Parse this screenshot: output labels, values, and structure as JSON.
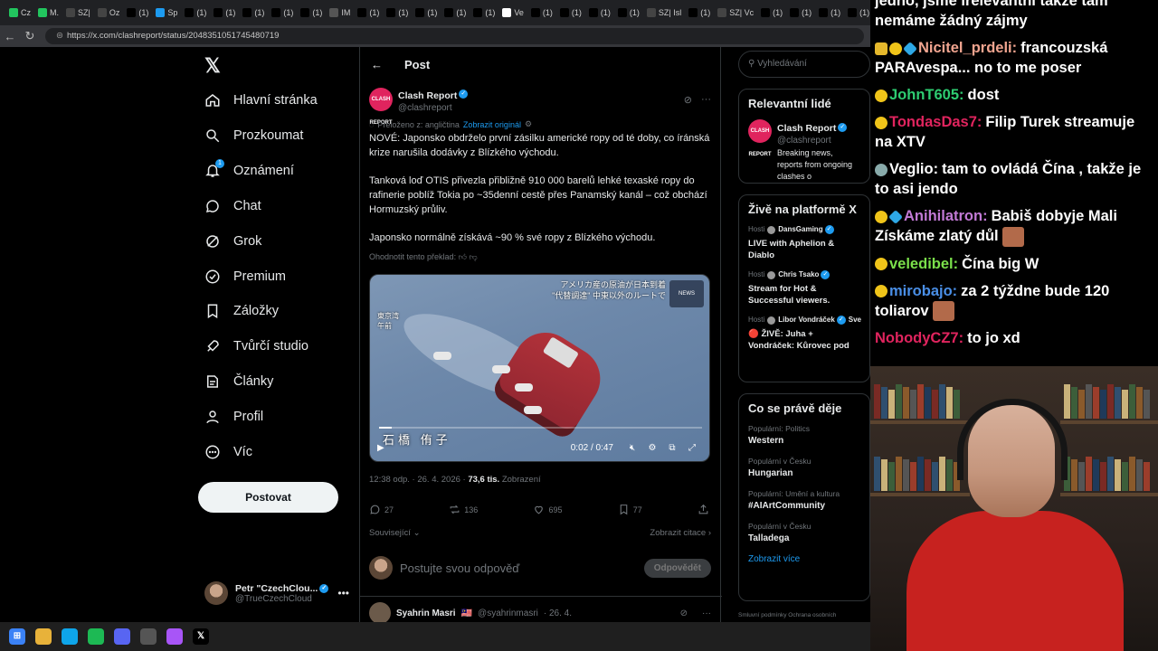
{
  "browser": {
    "tabs": [
      {
        "label": "Cz",
        "color": "#22c55e"
      },
      {
        "label": "M.",
        "color": "#22c55e"
      },
      {
        "label": "SZ|",
        "color": "#444"
      },
      {
        "label": "Oz",
        "color": "#444"
      },
      {
        "label": "(1)",
        "color": "#000"
      },
      {
        "label": "Sp",
        "color": "#1d9bf0"
      },
      {
        "label": "(1)",
        "color": "#000"
      },
      {
        "label": "(1)",
        "color": "#000"
      },
      {
        "label": "(1)",
        "color": "#000"
      },
      {
        "label": "(1)",
        "color": "#000"
      },
      {
        "label": "(1)",
        "color": "#000"
      },
      {
        "label": "IM",
        "color": "#555"
      },
      {
        "label": "(1)",
        "color": "#000"
      },
      {
        "label": "(1)",
        "color": "#000"
      },
      {
        "label": "(1)",
        "color": "#000"
      },
      {
        "label": "(1)",
        "color": "#000"
      },
      {
        "label": "(1)",
        "color": "#000"
      },
      {
        "label": "Ve",
        "color": "#fff"
      },
      {
        "label": "(1)",
        "color": "#000"
      },
      {
        "label": "(1)",
        "color": "#000"
      },
      {
        "label": "(1)",
        "color": "#000"
      },
      {
        "label": "(1)",
        "color": "#000"
      },
      {
        "label": "SZ| Isl",
        "color": "#444"
      },
      {
        "label": "(1)",
        "color": "#000"
      },
      {
        "label": "SZ| Vc",
        "color": "#444"
      },
      {
        "label": "(1)",
        "color": "#000"
      },
      {
        "label": "(1)",
        "color": "#000"
      },
      {
        "label": "(1)",
        "color": "#000"
      },
      {
        "label": "(1)",
        "color": "#000"
      },
      {
        "label": "(1)",
        "color": "#000"
      }
    ],
    "url": "https://x.com/clashreport/status/2048351051745480719"
  },
  "nav": {
    "items": [
      {
        "label": "Hlavní stránka",
        "icon": "home-icon"
      },
      {
        "label": "Prozkoumat",
        "icon": "search-icon"
      },
      {
        "label": "Oznámení",
        "icon": "bell-icon",
        "badge": "1"
      },
      {
        "label": "Chat",
        "icon": "chat-icon"
      },
      {
        "label": "Grok",
        "icon": "grok-icon"
      },
      {
        "label": "Premium",
        "icon": "premium-icon"
      },
      {
        "label": "Záložky",
        "icon": "bookmark-icon"
      },
      {
        "label": "Tvůrčí studio",
        "icon": "rocket-icon"
      },
      {
        "label": "Články",
        "icon": "article-icon"
      },
      {
        "label": "Profil",
        "icon": "profile-icon"
      },
      {
        "label": "Víc",
        "icon": "more-icon"
      }
    ],
    "post_button": "Postovat",
    "account": {
      "name": "Petr \"CzechClou...",
      "handle": "@TrueCzechCloud"
    }
  },
  "timeline": {
    "title": "Post",
    "post": {
      "author": "Clash Report",
      "handle": "@clashreport",
      "avatar_text": "CLASH REPORT",
      "translated_from": "Přeloženo z: angličtina",
      "show_original": "Zobrazit originál",
      "paragraphs": [
        "NOVÉ: Japonsko obdrželo první zásilku americké ropy od té doby, co íránská krize narušila dodávky z Blízkého východu.",
        "Tanková loď OTIS přivezla přibližně 910 000 barelů lehké texaské ropy do rafinerie poblíž Tokia po ~35denní cestě přes Panamský kanál – což obchází Hormuzský průliv.",
        "Japonsko normálně získává ~90 % své ropy z Blízkého východu."
      ],
      "rate_translation": "Ohodnotit tento překlad:",
      "video": {
        "caption_line1": "アメリカ産の原油が日本到着",
        "caption_line2": "\"代替調達\" 中東以外のルートで",
        "location_line1": "東京湾",
        "location_line2": "午前",
        "name_caption": "石橋 侑子",
        "watermark": "NEWS",
        "time": "0:02 / 0:47",
        "progress": 0.04
      },
      "time": "12:38 odp. · 26. 4. 2026 ·",
      "views": "73,6 tis.",
      "views_label": "Zobrazení",
      "stats": {
        "replies": "27",
        "reposts": "136",
        "likes": "695",
        "bookmarks": "77"
      },
      "sort_label": "Související",
      "quotes_label": "Zobrazit citace"
    },
    "reply": {
      "placeholder": "Postujte svou odpověď",
      "button": "Odpovědět"
    },
    "next_post": {
      "author": "Syahrin Masri",
      "handle": "@syahrinmasri",
      "date": "· 26. 4."
    }
  },
  "sidebar": {
    "search_placeholder": "Vyhledávání",
    "relevant_title": "Relevantní lidé",
    "relevant": {
      "name": "Clash Report",
      "handle": "@clashreport",
      "bio": "Breaking news, reports from ongoing clashes o"
    },
    "live_title": "Živě na platformě X",
    "live": [
      {
        "host_label": "Hosti",
        "host": "DansGaming",
        "title": "LIVE with Aphelion & Diablo"
      },
      {
        "host_label": "Hosti",
        "host": "Chris Tsako",
        "title": "Stream for Hot & Successful viewers. Hearthstones! Clas"
      },
      {
        "host_label": "Hosti",
        "host": "Libor Vondráček",
        "host_extra": "Sve",
        "title": "🔴 ŽIVĚ: Juha + Vondráček: Kůrovec pod kontrolou, ale ."
      }
    ],
    "trends_title": "Co se právě děje",
    "trends": [
      {
        "category": "Populární: Politics",
        "name": "Western"
      },
      {
        "category": "Populární v Česku",
        "name": "Hungarian"
      },
      {
        "category": "Populární: Umění a kultura",
        "name": "#AIArtCommunity"
      },
      {
        "category": "Populární v Česku",
        "name": "Talladega"
      }
    ],
    "show_more": "Zobrazit více",
    "footer": "Smluvní podmínky   Ochrana osobních"
  },
  "chat": {
    "messages": [
      {
        "user": "",
        "user_color": "#ffffff",
        "badges": [],
        "text": "jedno, jsme irelevantní takže tam nemáme žádný zájmy"
      },
      {
        "user": "Nicitel_prdeli:",
        "user_color": "#f0a48f",
        "badges": [
          "crown",
          "pill",
          "gem"
        ],
        "text": "francouzská PARAvespa... no to me poser"
      },
      {
        "user": "JohnT605:",
        "user_color": "#2ecc71",
        "badges": [
          "pill"
        ],
        "text": "dost"
      },
      {
        "user": "TondasDas7:",
        "user_color": "#e0245e",
        "badges": [
          "pill"
        ],
        "text": "Filip Turek streamuje na XTV"
      },
      {
        "user": "Veglio:",
        "user_color": "#ffffff",
        "badges": [
          "pill-grey"
        ],
        "text": "tam to ovládá Čína , takže je to asi jendo"
      },
      {
        "user": "Anihilatron:",
        "user_color": "#c27ad6",
        "badges": [
          "pill",
          "gem"
        ],
        "text": "Babiš dobyje Mali Získáme zlatý důl"
      },
      {
        "user": "veledibel:",
        "user_color": "#7be04b",
        "badges": [
          "pill"
        ],
        "text": "Čína big W"
      },
      {
        "user": "mirobajo:",
        "user_color": "#4a8fe7",
        "badges": [
          "pill"
        ],
        "text": "za 2 týždne bude 120 toliarov"
      },
      {
        "user": "NobodyCZ7:",
        "user_color": "#e0245e",
        "badges": [],
        "text": "to jo xd"
      }
    ]
  },
  "taskbar": {
    "icons": [
      {
        "name": "windows-start-icon",
        "color": "#3b82f6"
      },
      {
        "name": "file-explorer-icon",
        "color": "#e8b23a"
      },
      {
        "name": "edge-browser-icon",
        "color": "#0ea5e9"
      },
      {
        "name": "spotify-icon",
        "color": "#1db954"
      },
      {
        "name": "discord-icon",
        "color": "#5865f2"
      },
      {
        "name": "obs-icon",
        "color": "#555"
      },
      {
        "name": "copilot-icon",
        "color": "#a855f7"
      },
      {
        "name": "x-app-icon",
        "color": "#000"
      }
    ]
  }
}
